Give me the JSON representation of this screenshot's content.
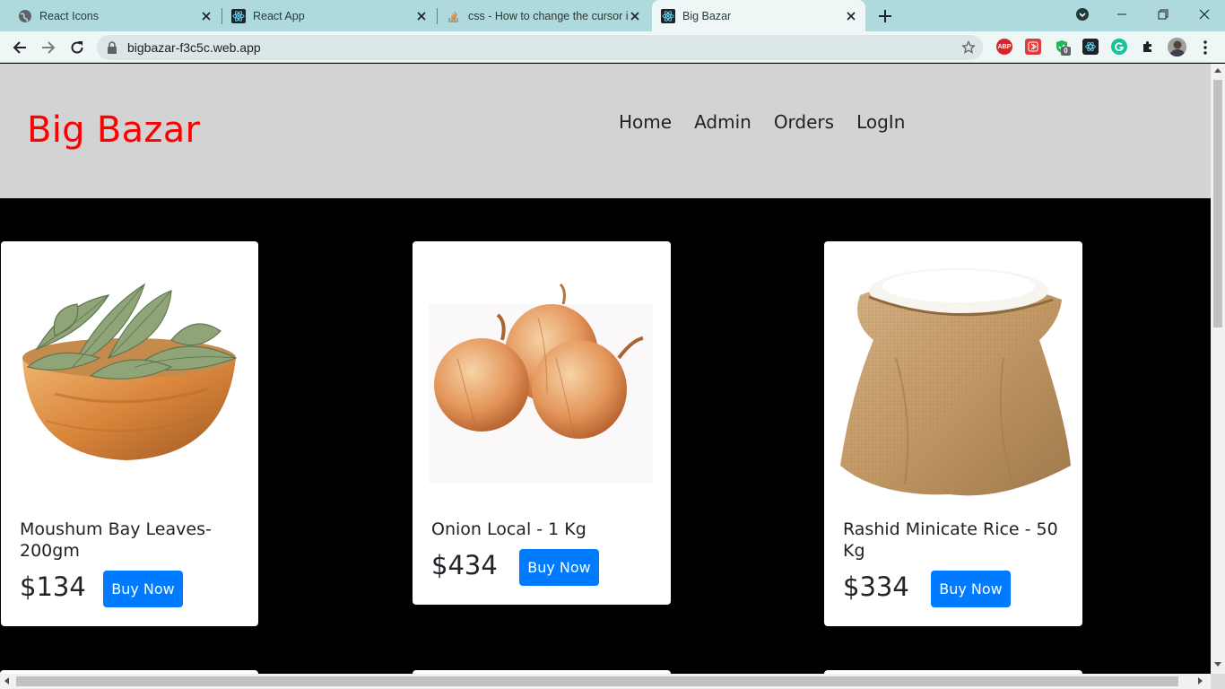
{
  "browser": {
    "tabs": [
      {
        "title": "React Icons",
        "icon": "globe-icon"
      },
      {
        "title": "React App",
        "icon": "react-icon"
      },
      {
        "title": "css - How to change the cursor i",
        "icon": "stackoverflow-icon"
      },
      {
        "title": "Big Bazar",
        "icon": "react-icon",
        "active": true
      }
    ],
    "url": "bigbazar-f3c5c.web.app",
    "extensions": [
      "ABP",
      "",
      "0",
      "",
      "",
      "",
      ""
    ],
    "colors": {
      "tabbar": "#aedadd",
      "toolbar": "#eef6f6"
    }
  },
  "site": {
    "brand": "Big Bazar",
    "brand_color": "#ff0000",
    "nav": [
      "Home",
      "Admin",
      "Orders",
      "LogIn"
    ]
  },
  "products": [
    {
      "name": "Moushum Bay Leaves-200gm",
      "name_line1": "Moushum Bay Leaves-",
      "name_line2": "200gm",
      "price": "$134",
      "button": "Buy Now",
      "image": "bay-leaves-bowl"
    },
    {
      "name": "Onion Local - 1 Kg",
      "name_line1": "Onion Local - 1 Kg",
      "name_line2": "",
      "price": "$434",
      "button": "Buy Now",
      "image": "onions"
    },
    {
      "name": "Rashid Minicate Rice - 50 Kg",
      "name_line1": "Rashid Minicate Rice - 50",
      "name_line2": "Kg",
      "price": "$334",
      "button": "Buy Now",
      "image": "rice-sack"
    }
  ],
  "button_color": "#007bff"
}
